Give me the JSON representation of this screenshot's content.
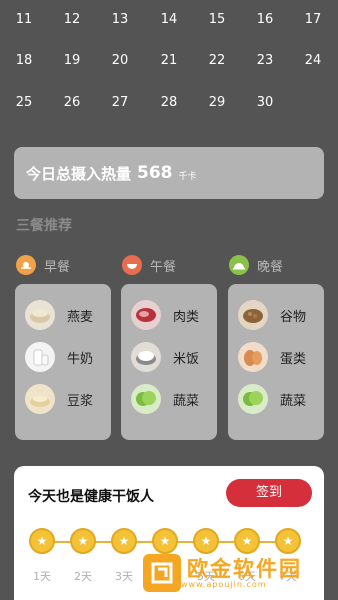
{
  "calendar": {
    "rows": [
      [
        "11",
        "12",
        "13",
        "14",
        "15",
        "16",
        "17"
      ],
      [
        "18",
        "19",
        "20",
        "21",
        "22",
        "23",
        "24"
      ],
      [
        "25",
        "26",
        "27",
        "28",
        "29",
        "30",
        ""
      ]
    ]
  },
  "summary": {
    "label": "今日总摄入热量",
    "value": "568",
    "unit": "千卡"
  },
  "section_title": "三餐推荐",
  "meals": [
    {
      "title": "早餐",
      "icon": "sun-icon",
      "icon_color": "#f0a24a",
      "items": [
        {
          "label": "燕麦",
          "icon": "oats-icon"
        },
        {
          "label": "牛奶",
          "icon": "milk-icon"
        },
        {
          "label": "豆浆",
          "icon": "soymilk-icon"
        }
      ]
    },
    {
      "title": "午餐",
      "icon": "bowl-icon",
      "icon_color": "#e86d4f",
      "items": [
        {
          "label": "肉类",
          "icon": "meat-icon"
        },
        {
          "label": "米饭",
          "icon": "rice-icon"
        },
        {
          "label": "蔬菜",
          "icon": "vegetable-icon"
        }
      ]
    },
    {
      "title": "晚餐",
      "icon": "cloche-icon",
      "icon_color": "#8cc04a",
      "items": [
        {
          "label": "谷物",
          "icon": "grain-icon"
        },
        {
          "label": "蛋类",
          "icon": "egg-icon"
        },
        {
          "label": "蔬菜",
          "icon": "vegetable-icon"
        }
      ]
    }
  ],
  "checkin": {
    "title": "今天也是健康干饭人",
    "button": "签到",
    "days": [
      "1天",
      "2天",
      "3天",
      "4天",
      "5天",
      "6天",
      "7天"
    ],
    "coin_color": "#f4c237",
    "button_color": "#d42f3a"
  },
  "watermark": {
    "text": "欧金软件园",
    "sub": "www.apoujin.com"
  }
}
